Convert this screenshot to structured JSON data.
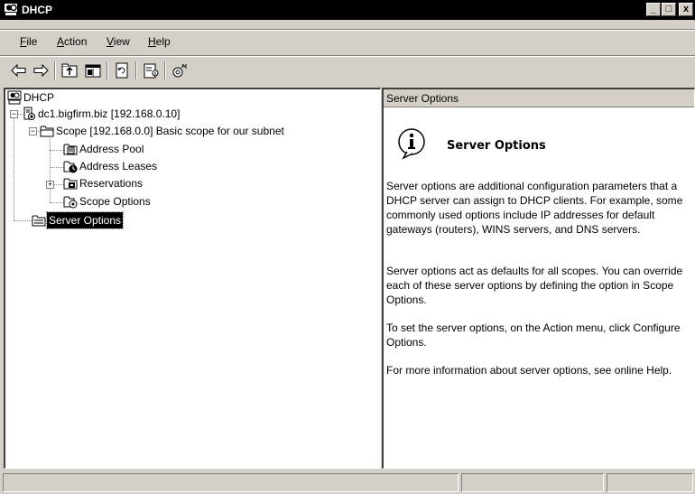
{
  "window": {
    "title": "DHCP",
    "controls": {
      "minimize": "_",
      "maximize": "□",
      "close": "x"
    }
  },
  "menu": {
    "file": {
      "hot": "F",
      "rest": "ile"
    },
    "action": {
      "hot": "A",
      "rest": "ction"
    },
    "view": {
      "hot": "V",
      "rest": "iew"
    },
    "help": {
      "hot": "H",
      "rest": "elp"
    }
  },
  "toolbar": {
    "icons": [
      "back-arrow-icon",
      "forward-arrow-icon",
      "up-one-level-icon",
      "show-hide-tree-icon",
      "refresh-icon",
      "properties-icon",
      "help-icon"
    ]
  },
  "tree": {
    "root": "DHCP",
    "server": "dc1.bigfirm.biz [192.168.0.10]",
    "scope": "Scope [192.168.0.0] Basic scope for our subnet",
    "address_pool": "Address Pool",
    "address_leases": "Address Leases",
    "reservations": "Reservations",
    "scope_options": "Scope Options",
    "server_options": "Server Options",
    "selected": "Server Options"
  },
  "detail": {
    "header": "Server Options",
    "title": "Server Options",
    "paragraphs": [
      "Server options are additional configuration parameters that a DHCP server can assign to DHCP clients. For example, some commonly used options include IP addresses for default gateways (routers), WINS servers, and DNS servers.",
      "Server options act as defaults for all scopes.  You can override each of these server options by defining the option in Scope Options.",
      "To set the server options, on the Action menu, click Configure Options.",
      "For more information about server options, see online Help."
    ]
  },
  "statusbar": {
    "cells": [
      "",
      "",
      ""
    ]
  }
}
